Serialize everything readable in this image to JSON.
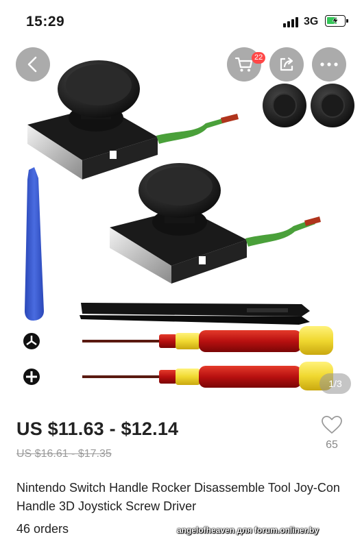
{
  "status_bar": {
    "time": "15:29",
    "network": "3G",
    "battery_icon": "battery-charging-icon",
    "signal_icon": "cellular-signal-icon"
  },
  "header_buttons": {
    "back_icon": "chevron-left-icon",
    "cart_icon": "shopping-cart-icon",
    "cart_badge": "22",
    "share_icon": "share-icon",
    "more_icon": "more-dots-icon"
  },
  "gallery": {
    "counter": "1/3",
    "items": [
      "joystick-module",
      "joystick-module",
      "thumbstick-caps",
      "pry-tool",
      "tweezers",
      "screwdriver-y",
      "screwdriver-cross"
    ]
  },
  "product": {
    "price": "US $11.63 - $12.14",
    "original_price": "US $16.61 - $17.35",
    "wishlist_count": "65",
    "title": "Nintendo Switch Handle Rocker Disassemble Tool Joy-Con Handle 3D Joystick Screw Driver",
    "orders": "46 orders"
  },
  "watermark": "angelofheaven для forum.onliner.by",
  "colors": {
    "badge": "#ff4747",
    "overlay_button": "#787878",
    "battery_charge": "#35c759",
    "screwdriver_red": "#c81a1a",
    "screwdriver_yellow": "#f2e24a",
    "pry_tool_blue": "#3f5fd0"
  }
}
